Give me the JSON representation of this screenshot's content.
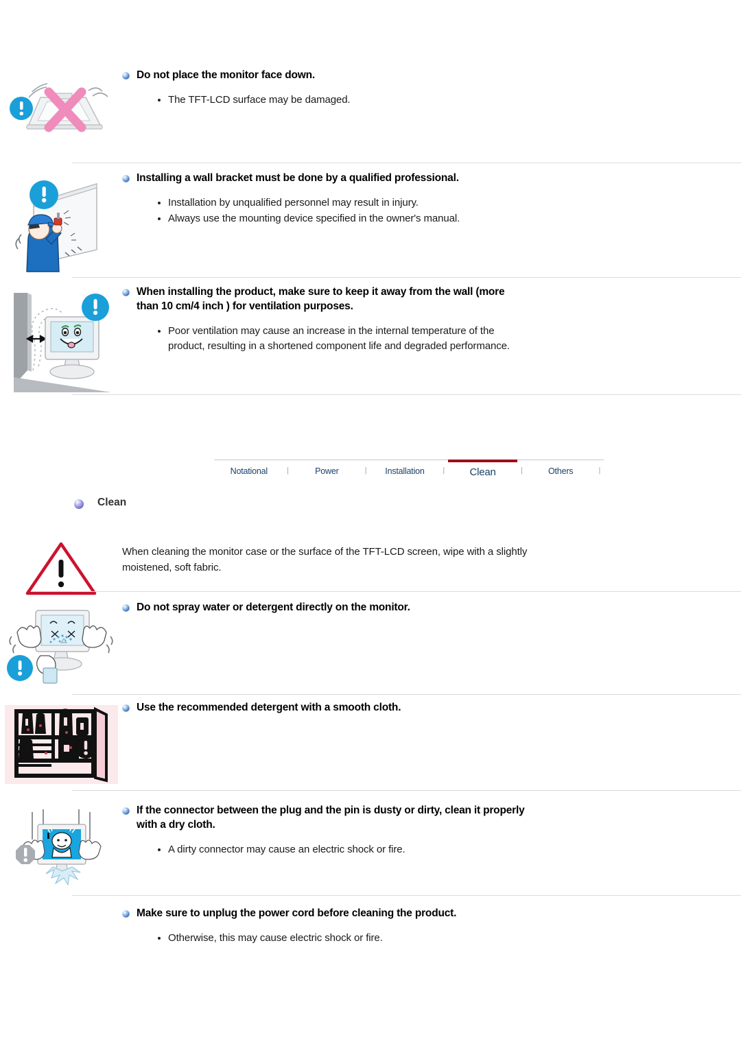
{
  "document": {
    "type": "monitor-user-manual-safety-page"
  },
  "sections": [
    {
      "id": "face-down",
      "heading": "Do not place the monitor face down.",
      "bullets": [
        "The TFT-LCD surface may be damaged."
      ],
      "icon": "monitor-face-down-prohibited-illustration"
    },
    {
      "id": "wall-bracket",
      "heading": "Installing a wall bracket must be done by a qualified professional.",
      "bullets": [
        "Installation by unqualified personnel may result in injury.",
        "Always use the mounting device specified in the owner's manual."
      ],
      "icon": "worker-installing-wall-bracket-illustration"
    },
    {
      "id": "ventilation",
      "heading": "When installing the product, make sure to keep it away from the wall (more than 10 cm/4 inch ) for ventilation purposes.",
      "bullets": [
        "Poor ventilation may cause an increase in the internal temperature of the product, resulting in a shortened component life and degraded performance."
      ],
      "icon": "monitor-spaced-from-wall-illustration"
    },
    {
      "id": "clean-general",
      "heading": "",
      "paragraph": "When cleaning the monitor case or the surface of the TFT-LCD screen, wipe with a slightly moistened, soft fabric.",
      "icon": "warning-triangle-icon"
    },
    {
      "id": "no-spray",
      "heading": "Do not spray water or detergent directly on the monitor.",
      "bullets": [],
      "icon": "monitor-sprayed-with-water-illustration"
    },
    {
      "id": "recommended-detergent",
      "heading": "Use the recommended detergent with a smooth cloth.",
      "bullets": [],
      "icon": "cleaning-supplies-shelf-illustration"
    },
    {
      "id": "dirty-connector",
      "heading": "If the connector between the plug and the pin is dusty or dirty, clean it properly with a dry cloth.",
      "bullets": [
        "A dirty connector may cause an electric shock or fire."
      ],
      "icon": "monitor-electric-shock-illustration"
    },
    {
      "id": "unplug-before-clean",
      "heading": "Make sure to unplug the power cord before cleaning the product.",
      "bullets": [
        "Otherwise, this may cause electric shock or fire."
      ],
      "icon": null
    }
  ],
  "tabs": {
    "items": [
      {
        "label": "Notational",
        "active": false
      },
      {
        "label": "Power",
        "active": false
      },
      {
        "label": "Installation",
        "active": false
      },
      {
        "label": "Clean",
        "active": true
      },
      {
        "label": "Others",
        "active": false
      }
    ],
    "separator": "|"
  },
  "clean_header": {
    "label": "Clean",
    "bullet": "purple-sphere-bullet"
  },
  "colors": {
    "active_tab_underline": "#9e0b1b",
    "tab_text": "#19416b",
    "tab_divider": "#c9c4d4",
    "rule": "#dcdcdc",
    "heading_bullet_blue": "#2f66b5",
    "clean_bullet_purple": "#7a74cf",
    "warning_triangle_red": "#cc1230",
    "prohibition_x_pink": "#ef8cbb",
    "info_circle_blue": "#1a9fd9",
    "detergent_bg_pink": "#fbe9ec",
    "screen_blue": "#18a5e0"
  }
}
